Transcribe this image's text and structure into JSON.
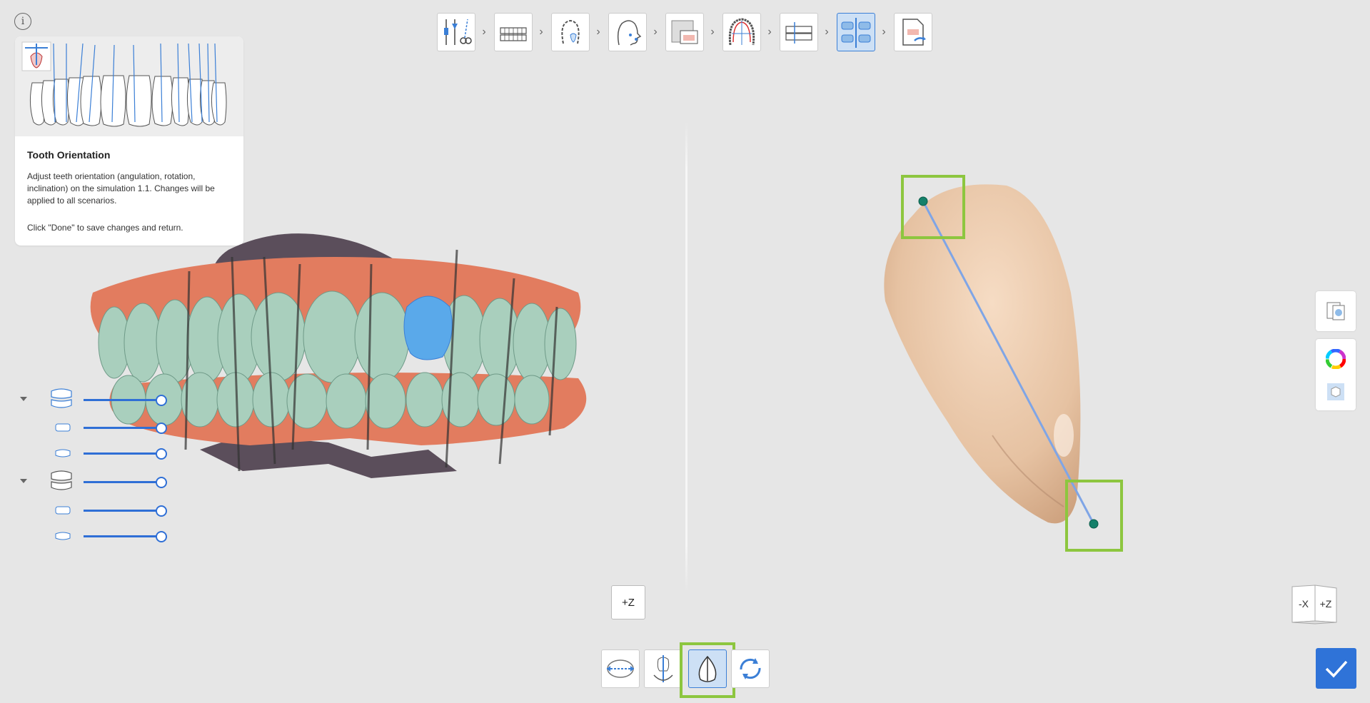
{
  "info": {
    "label": "i"
  },
  "help_panel": {
    "title": "Tooth Orientation",
    "description": "Adjust teeth orientation (angulation, rotation, inclination) on the simulation 1.1. Changes will be applied to all scenarios.",
    "hint": "Click \"Done\" to save changes and return."
  },
  "workflow_steps": [
    {
      "icon": "tools-icon"
    },
    {
      "icon": "jaw-scan-icon"
    },
    {
      "icon": "arch-tooth-icon"
    },
    {
      "icon": "face-profile-icon"
    },
    {
      "icon": "xray-overlay-icon"
    },
    {
      "icon": "arch-setup-icon"
    },
    {
      "icon": "occlusion-icon"
    },
    {
      "icon": "tooth-orientation-icon",
      "active": true
    },
    {
      "icon": "export-icon"
    }
  ],
  "left_view": {
    "z_button": "+Z",
    "sliders": [
      {
        "name": "upper-jaw",
        "value": 1.0,
        "collapsible": true
      },
      {
        "name": "upper-teeth",
        "value": 1.0
      },
      {
        "name": "upper-gums",
        "value": 1.0
      },
      {
        "name": "lower-jaw",
        "value": 1.0,
        "collapsible": true
      },
      {
        "name": "lower-teeth",
        "value": 1.0
      },
      {
        "name": "lower-gums",
        "value": 1.0
      }
    ]
  },
  "right_view": {
    "view_cube": {
      "left": "-X",
      "right": "+Z"
    }
  },
  "bottom_tools": [
    {
      "icon": "move-axis-icon"
    },
    {
      "icon": "anchor-rotate-icon"
    },
    {
      "icon": "tooth-axis-icon",
      "active": true
    },
    {
      "icon": "reset-rotate-icon"
    }
  ],
  "right_tools": [
    "compare-view-icon",
    "color-wheel-icon",
    "cube-view-icon"
  ],
  "colors": {
    "accent": "#2f73d8",
    "highlight": "#8dc63f",
    "selected_tooth": "#5aa9ea",
    "teeth": "#a9cdbd",
    "gums": "#e07a5f"
  }
}
